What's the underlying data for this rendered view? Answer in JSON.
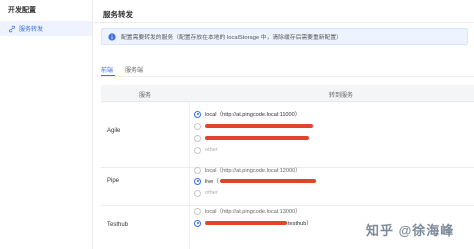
{
  "sidebar": {
    "title": "开发配置",
    "items": [
      {
        "label": "服务转发",
        "icon": "link-icon"
      }
    ]
  },
  "header": {
    "title": "服务转发"
  },
  "alert": {
    "icon": "info-icon",
    "text": "配置需要转发的服务（配置存放在本地的 localStorage 中，清除缓存后需要重新配置）"
  },
  "tabs": [
    {
      "label": "前端",
      "active": true
    },
    {
      "label": "服务端",
      "active": false
    }
  ],
  "table": {
    "columns": [
      "服务",
      "转到服务"
    ],
    "rows": [
      {
        "name": "Agile",
        "options": [
          {
            "label": "local（http://at.pingcode.local:11000）",
            "checked": true
          },
          {
            "label": "",
            "checked": false,
            "redacted": true
          },
          {
            "label": "",
            "checked": false,
            "redacted": true
          },
          {
            "label": "other",
            "checked": false
          }
        ]
      },
      {
        "name": "Pipe",
        "options": [
          {
            "label": "local（http://at.pingcode.local:12000）",
            "checked": false
          },
          {
            "label": "live（",
            "checked": true,
            "redacted": true
          },
          {
            "label": "other",
            "checked": false
          }
        ]
      },
      {
        "name": "Testhub",
        "options": [
          {
            "label": "local（http://at.pingcode.local:13000）",
            "checked": false
          },
          {
            "label": "testhub）",
            "checked": true,
            "redacted": true
          }
        ]
      }
    ]
  },
  "watermark": "知乎 @徐海峰",
  "colors": {
    "accent": "#3d6ee6",
    "redaction": "#e0442c"
  }
}
